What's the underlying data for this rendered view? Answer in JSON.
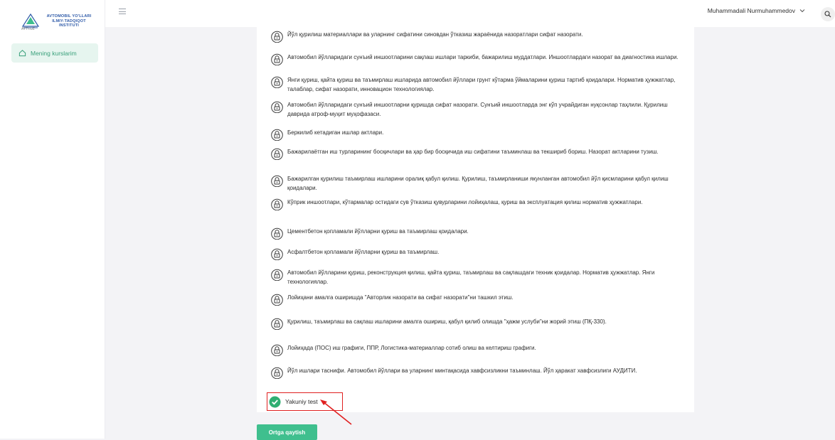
{
  "sidebar": {
    "logo_text": "AVTOMOBIL YO'LLARI ILMIY-TADQIQOT INSTITUTI",
    "logo_sub": "AYTI.UZ",
    "nav_items": [
      {
        "label": "Mening kurslarim",
        "icon": "home-icon"
      }
    ]
  },
  "topbar": {
    "user_name": "Muhammadali Nurmuhammedov"
  },
  "lessons": [
    {
      "text": "Йўл қурилиш материаллари ва уларнинг сифатини синовдан ўтказиш жараёнида назоратлари сифат назорати.",
      "status": "locked"
    },
    {
      "text": "Автомобил йўлларидаги сунъий иншоотларини сақлаш ишлари таркиби, бажарилиш муддатлари. Иншоотлардаги назорат ва диагностика ишлари.",
      "status": "locked"
    },
    {
      "text": "Янги қуриш, қайта қуриш ва таъмирлаш ишларида автомобил йўллари грунт кўтарма ўймаларини қуриш тартиб қоидалари. Норматив ҳужжатлар, талаблар, сифат назорати, инновацион технологиялар.",
      "status": "locked"
    },
    {
      "text": "Автомобил йўлларидаги сунъий иншоотларни қуришда сифат назорати. Сунъий иншоотларда энг кўп учрайдиган нуқсонлар таҳлили. Қурилиш даврида атроф-муҳит муҳофазаси.",
      "status": "locked"
    },
    {
      "text": "Беркилиб кетадиган ишлар актлари.",
      "status": "locked"
    },
    {
      "text": "Бажарилаётган иш турларининг босқичлари ва ҳар бир босқичида иш сифатини таъминлаш ва текшириб бориш. Назорат актларини тузиш.",
      "status": "locked"
    },
    {
      "text": "Бажарилган қурилиш таъмирлаш ишларини оралиқ қабул қилиш. Қурилиш, таъмирланиши якунланган автомобил йўл қисмларини қабул қилиш қоидалари.",
      "status": "locked"
    },
    {
      "text": "Кўприк иншоотлари, кўтармалар остидаги сув ўтказиш қувурларини лойиҳалаш, қуриш ва эксплуатация қилиш норматив ҳужжатлари.",
      "status": "locked"
    },
    {
      "text": "Цементбетон қопламали йўлларни қуриш ва таъмирлаш қоидалари.",
      "status": "locked"
    },
    {
      "text": "Асфалтбетон қопламали йўлларни қуриш ва таъмирлаш.",
      "status": "locked"
    },
    {
      "text": "Автомобил йўлларини қуриш, реконструкция қилиш, қайта қуриш, таъмирлаш ва сақлашдаги техник қоидалар. Норматив ҳужжатлар. Янги технологиялар.",
      "status": "locked"
    },
    {
      "text": "Лойиҳани амалга оширишда \"Авторлик назорати ва сифат назорати\"ни ташкил этиш.",
      "status": "locked"
    },
    {
      "text": "Қурилиш, таъмирлаш ва сақлаш ишларини амалга ошириш, қабул қилиб олишда \"ҳажм услуби\"ни жорий этиш (ПҚ-330).",
      "status": "locked"
    },
    {
      "text": "Лойиҳада (ПОС) иш графиги, ППР, Логистика-материаллар сотиб олиш ва келтириш графиги.",
      "status": "locked"
    },
    {
      "text": "Йўл ишлари таснифи. Автомобил йўллари ва уларнинг минтақасида хавфсизликни таъминлаш. Йўл ҳаракат хавфсизлиги АУДИТИ.",
      "status": "locked"
    }
  ],
  "final_test": {
    "label": "Yakuniy test",
    "status": "completed"
  },
  "back_button": "Ortga qaytish",
  "colors": {
    "accent": "#3fbf8e",
    "highlight": "#e02020"
  }
}
